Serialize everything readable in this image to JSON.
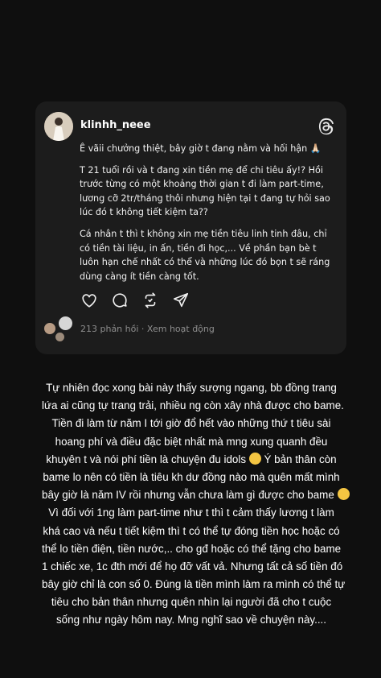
{
  "post": {
    "username": "klinhh_neee",
    "paragraphs": [
      "Ê vãii chưởng thiệt, bây giờ t đang nằm và hối hận 🙏🏻",
      "T 21 tuổi rồi và t đang xin tiền mẹ để chi tiêu ấy!? Hồi trước từng có một khoảng thời gian t đi làm part-time, lương cỡ 2tr/tháng thôi nhưng hiện tại t đang tự hỏi sao lúc đó t không tiết kiệm ta??",
      "Cá nhân t thì t không xin mẹ tiền tiêu linh tinh đâu, chỉ có tiền tài liệu, in ấn, tiền đi học,... Về phần bạn bè t luôn hạn chế nhất có thể và những lúc đó bọn t sẽ ráng dùng càng ít tiền càng tốt."
    ],
    "replies_count": "213 phản hồi",
    "separator": "·",
    "view_activity": "Xem hoạt động",
    "icons": [
      "heart-icon",
      "comment-icon",
      "repost-icon",
      "share-icon",
      "threads-logo-icon"
    ]
  },
  "caption": {
    "lines": [
      "Tự nhiên đọc xong bài này thấy sượng ngang, bb đồng trang",
      "lứa ai cũng tự trang trải, nhiều ng còn xây nhà được cho bame.",
      "Tiền đi làm từ năm I tới giờ đổ hết vào những thứ t tiêu sài",
      "hoang phí và điều đặc biệt nhất mà mng xung quanh đều",
      "khuyên t và nói phí tiền là chuyện đu idols",
      "Ý bản thân còn",
      "bame lo nên có tiền là tiêu kh dư đồng nào mà quên mất mình",
      "bây giờ là năm IV rồi nhưng vẫn chưa làm gì được cho bame",
      "Vì đối với 1ng làm part-time như t thì t cảm thấy lương t làm",
      "khá cao và nếu t tiết kiệm thì t có thể tự đóng tiền học hoặc có",
      "thể lo tiền điện, tiền nước,.. cho gđ hoặc có thể tặng cho bame",
      "1 chiếc xe, 1c đth mới để họ đỡ vất vả. Nhưng tất cả số tiền đó",
      "bây giờ chỉ là con số 0. Đúng là tiền mình làm ra mình có thể tự",
      "tiêu cho bản thân nhưng quên nhìn lại người đã cho t cuộc",
      "sống như ngày hôm nay. Mng nghĩ sao về chuyện này...."
    ]
  }
}
